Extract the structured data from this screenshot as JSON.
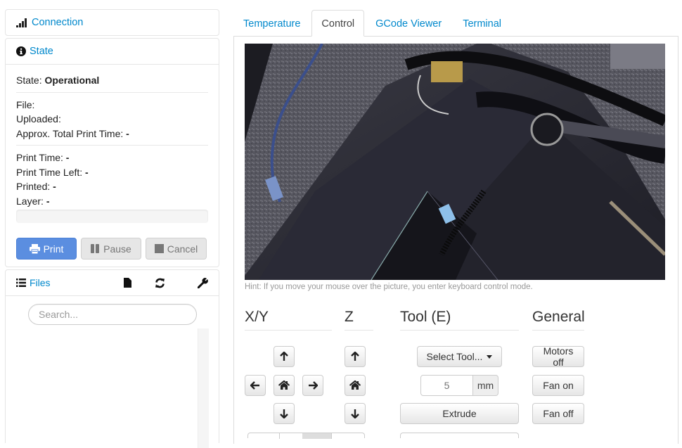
{
  "sidebar": {
    "connection": {
      "title": "Connection",
      "icon": "signal-icon"
    },
    "state": {
      "title": "State",
      "icon": "info-circle-icon",
      "state_label": "State:",
      "state_value": "Operational",
      "file_label": "File:",
      "file_value": "",
      "uploaded_label": "Uploaded:",
      "uploaded_value": "",
      "approx_label": "Approx. Total Print Time:",
      "approx_value": "-",
      "print_time_label": "Print Time:",
      "print_time_value": "-",
      "print_time_left_label": "Print Time Left:",
      "print_time_left_value": "-",
      "printed_label": "Printed:",
      "printed_value": "-",
      "layer_label": "Layer:",
      "layer_value": "-",
      "progress_percent": 0,
      "buttons": {
        "print": "Print",
        "pause": "Pause",
        "cancel": "Cancel"
      }
    },
    "files": {
      "title": "Files",
      "search_placeholder": "Search...",
      "tools": [
        "upload-file-icon",
        "refresh-icon",
        "wrench-icon"
      ]
    }
  },
  "tabs": [
    {
      "label": "Temperature",
      "active": false
    },
    {
      "label": "Control",
      "active": true
    },
    {
      "label": "GCode Viewer",
      "active": false
    },
    {
      "label": "Terminal",
      "active": false
    }
  ],
  "control": {
    "hint": "Hint: If you move your mouse over the picture, you enter keyboard control mode.",
    "columns": {
      "xy": "X/Y",
      "z": "Z",
      "tool": "Tool (E)",
      "general": "General"
    },
    "tool": {
      "select_label": "Select Tool...",
      "amount_value": "5",
      "amount_unit": "mm",
      "extrude_label": "Extrude"
    },
    "general": {
      "motors_off": "Motors off",
      "fan_on": "Fan on",
      "fan_off": "Fan off"
    }
  }
}
